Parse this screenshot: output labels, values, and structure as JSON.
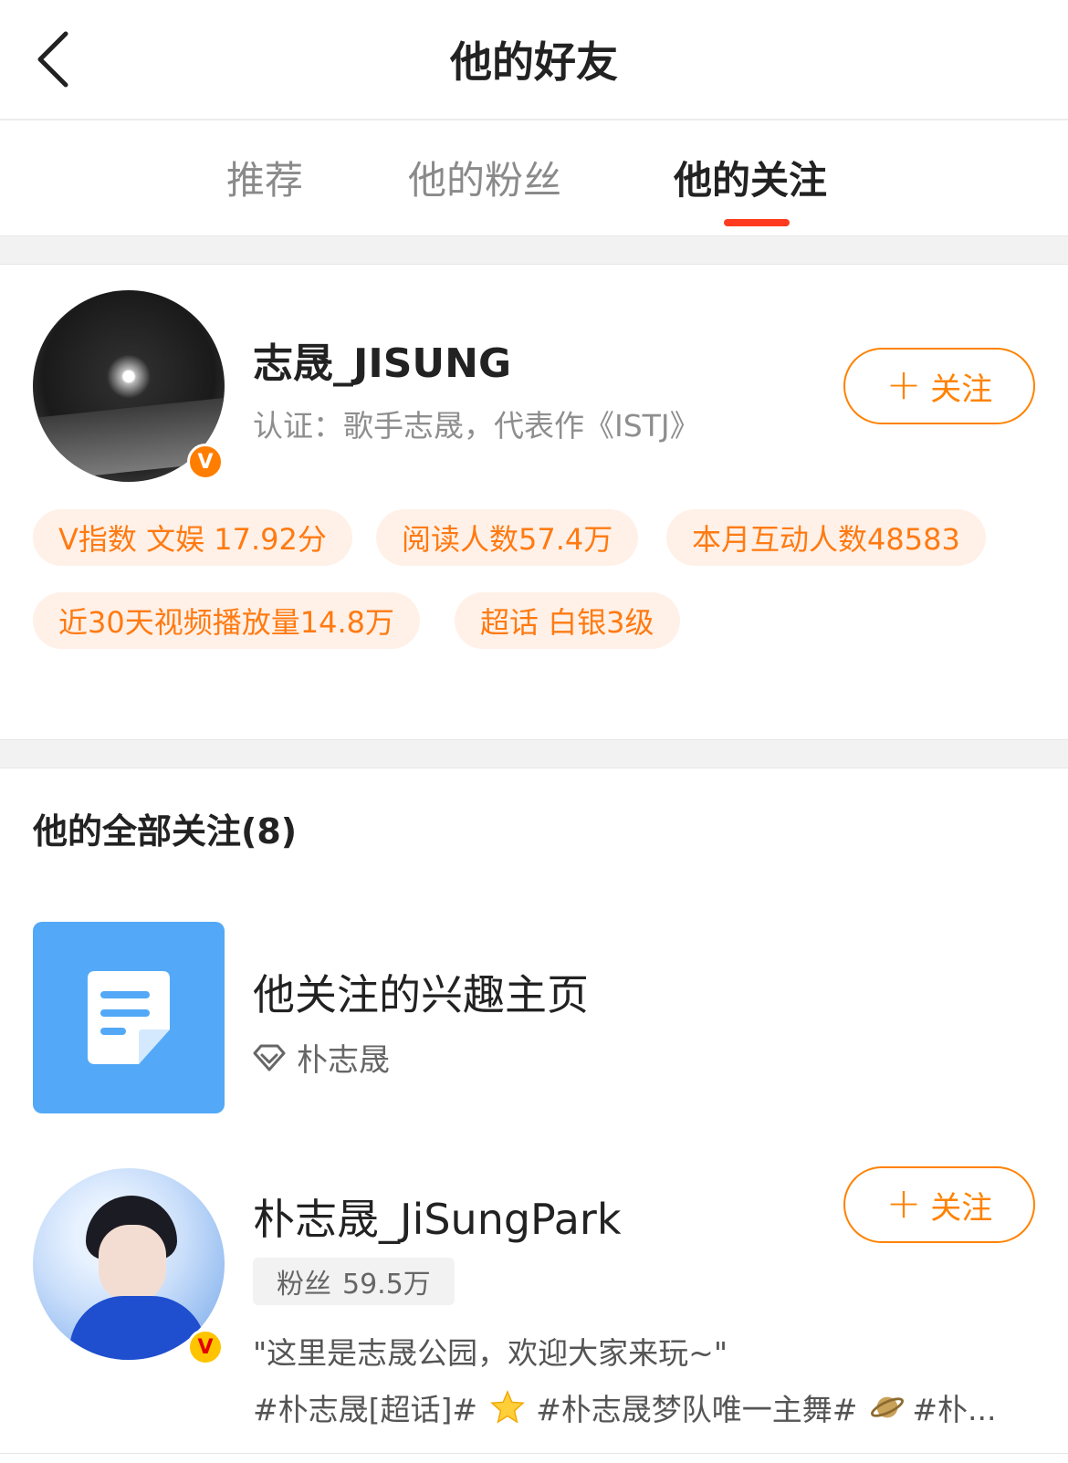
{
  "header": {
    "title": "他的好友",
    "back_icon": "chevron-left-icon"
  },
  "tabs": [
    {
      "label": "推荐",
      "active": false
    },
    {
      "label": "他的粉丝",
      "active": false
    },
    {
      "label": "他的关注",
      "active": true
    }
  ],
  "colors": {
    "accent": "#ff8200",
    "tab_indicator": "#ff3b1f",
    "tag_bg": "#fff1e8",
    "tag_text": "#ff7a12",
    "interest_blue": "#53a9f7"
  },
  "profile": {
    "name": "志晟_JISUNG",
    "verification": "认证：歌手志晟，代表作《ISTJ》",
    "badge": "V",
    "follow_label": "关注",
    "tags": [
      "V指数 文娱 17.92分",
      "阅读人数57.4万",
      "本月互动人数48583",
      "近30天视频播放量14.8万",
      "超话 白银3级"
    ]
  },
  "following": {
    "section_title": "他的全部关注(8)",
    "interest": {
      "title": "他关注的兴趣主页",
      "subtitle": "朴志晟"
    },
    "users": [
      {
        "name": "朴志晟_JiSungPark",
        "badge": "V",
        "fans_label": "粉丝",
        "fans_count": "59.5万",
        "follow_label": "关注",
        "bio": "\"这里是志晟公园，欢迎大家来玩~\"",
        "topic_1": "#朴志晟[超话]#",
        "topic_2": "#朴志晟梦队唯一主舞#",
        "topic_3": "#朴..."
      }
    ]
  }
}
